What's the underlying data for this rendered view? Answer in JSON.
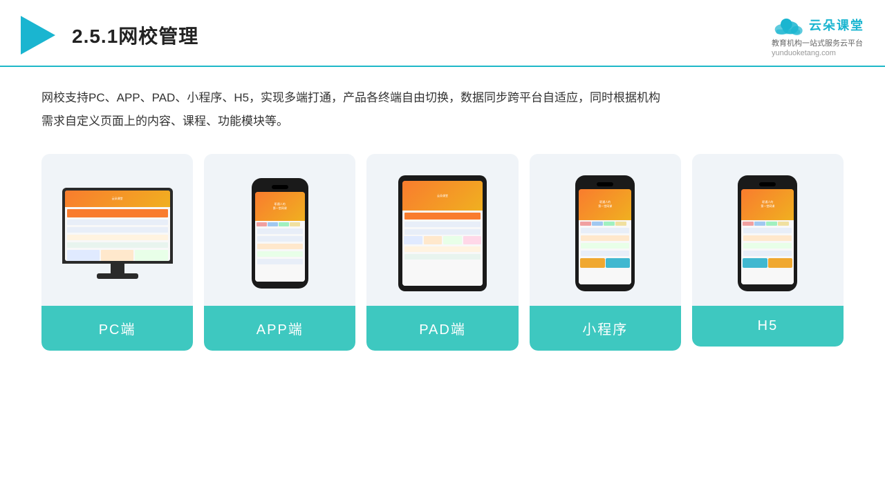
{
  "header": {
    "title": "2.5.1网校管理",
    "brand_name": "云朵课堂",
    "brand_url": "yunduoketang.com",
    "brand_subtitle_line1": "教育机构一站",
    "brand_subtitle_line2": "式服务云平台"
  },
  "description": {
    "text1": "网校支持PC、APP、PAD、小程序、H5，实现多端打通，产品各终端自由切换，数据同步跨平台自适应，同时根据机构",
    "text2": "需求自定义页面上的内容、课程、功能模块等。"
  },
  "cards": [
    {
      "id": "pc",
      "label": "PC端"
    },
    {
      "id": "app",
      "label": "APP端"
    },
    {
      "id": "pad",
      "label": "PAD端"
    },
    {
      "id": "miniprogram",
      "label": "小程序"
    },
    {
      "id": "h5",
      "label": "H5"
    }
  ],
  "colors": {
    "accent": "#3ec8c0",
    "header_line": "#1db8c8",
    "triangle": "#1ab5d0"
  }
}
